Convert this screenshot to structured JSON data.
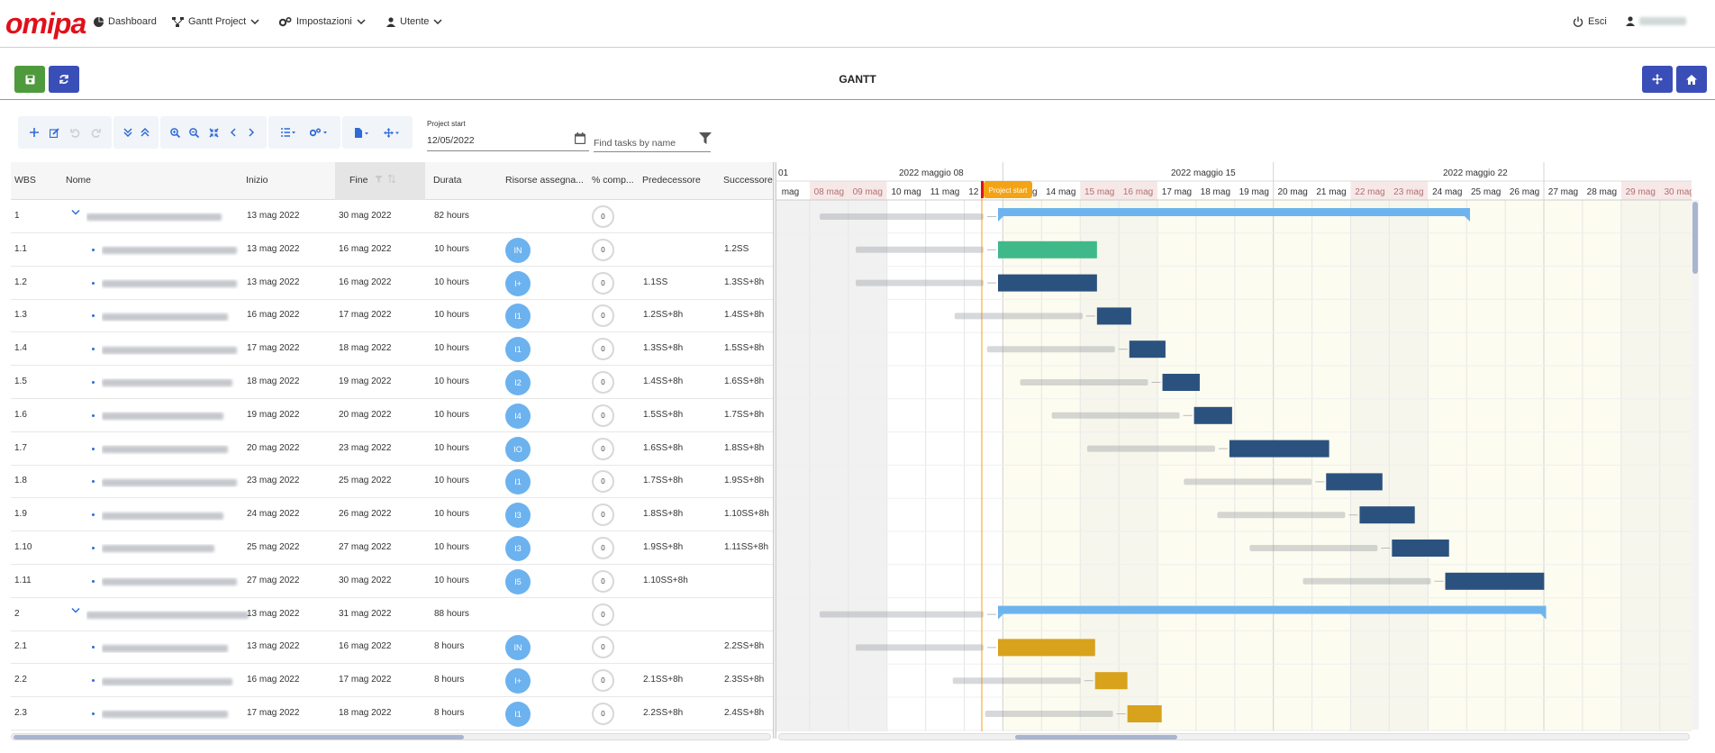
{
  "nav": {
    "logo": "omipa",
    "dashboard": "Dashboard",
    "gantt_project": "Gantt Project",
    "impostazioni": "Impostazioni",
    "utente": "Utente",
    "esci": "Esci"
  },
  "page": {
    "title": "GANTT"
  },
  "toolbar": {
    "project_start_label": "Project start",
    "project_start_value": "12/05/2022",
    "find_placeholder": "Find tasks by name"
  },
  "columns": {
    "wbs": "WBS",
    "nome": "Nome",
    "inizio": "Inizio",
    "fine": "Fine",
    "durata": "Durata",
    "risorse": "Risorse assegna...",
    "comp": "% comp...",
    "predecessore": "Predecessore",
    "successore": "Successore"
  },
  "rows": [
    {
      "wbs": "1",
      "start": "13 mag 2022",
      "end": "30 mag 2022",
      "dur": "82 hours",
      "res": "",
      "pct": "0",
      "pred": "",
      "succ": "",
      "parent": true
    },
    {
      "wbs": "1.1",
      "start": "13 mag 2022",
      "end": "16 mag 2022",
      "dur": "10 hours",
      "res": "IN",
      "pct": "0",
      "pred": "",
      "succ": "1.2SS"
    },
    {
      "wbs": "1.2",
      "start": "13 mag 2022",
      "end": "16 mag 2022",
      "dur": "10 hours",
      "res": "I+",
      "pct": "0",
      "pred": "1.1SS",
      "succ": "1.3SS+8h"
    },
    {
      "wbs": "1.3",
      "start": "16 mag 2022",
      "end": "17 mag 2022",
      "dur": "10 hours",
      "res": "I1",
      "pct": "0",
      "pred": "1.2SS+8h",
      "succ": "1.4SS+8h"
    },
    {
      "wbs": "1.4",
      "start": "17 mag 2022",
      "end": "18 mag 2022",
      "dur": "10 hours",
      "res": "I1",
      "pct": "0",
      "pred": "1.3SS+8h",
      "succ": "1.5SS+8h"
    },
    {
      "wbs": "1.5",
      "start": "18 mag 2022",
      "end": "19 mag 2022",
      "dur": "10 hours",
      "res": "I2",
      "pct": "0",
      "pred": "1.4SS+8h",
      "succ": "1.6SS+8h"
    },
    {
      "wbs": "1.6",
      "start": "19 mag 2022",
      "end": "20 mag 2022",
      "dur": "10 hours",
      "res": "I4",
      "pct": "0",
      "pred": "1.5SS+8h",
      "succ": "1.7SS+8h"
    },
    {
      "wbs": "1.7",
      "start": "20 mag 2022",
      "end": "23 mag 2022",
      "dur": "10 hours",
      "res": "IO",
      "pct": "0",
      "pred": "1.6SS+8h",
      "succ": "1.8SS+8h"
    },
    {
      "wbs": "1.8",
      "start": "23 mag 2022",
      "end": "25 mag 2022",
      "dur": "10 hours",
      "res": "I1",
      "pct": "0",
      "pred": "1.7SS+8h",
      "succ": "1.9SS+8h"
    },
    {
      "wbs": "1.9",
      "start": "24 mag 2022",
      "end": "26 mag 2022",
      "dur": "10 hours",
      "res": "I3",
      "pct": "0",
      "pred": "1.8SS+8h",
      "succ": "1.10SS+8h"
    },
    {
      "wbs": "1.10",
      "start": "25 mag 2022",
      "end": "27 mag 2022",
      "dur": "10 hours",
      "res": "I3",
      "pct": "0",
      "pred": "1.9SS+8h",
      "succ": "1.11SS+8h"
    },
    {
      "wbs": "1.11",
      "start": "27 mag 2022",
      "end": "30 mag 2022",
      "dur": "10 hours",
      "res": "I5",
      "pct": "0",
      "pred": "1.10SS+8h",
      "succ": ""
    },
    {
      "wbs": "2",
      "start": "13 mag 2022",
      "end": "31 mag 2022",
      "dur": "88 hours",
      "res": "",
      "pct": "0",
      "pred": "",
      "succ": "",
      "parent": true
    },
    {
      "wbs": "2.1",
      "start": "13 mag 2022",
      "end": "16 mag 2022",
      "dur": "8 hours",
      "res": "IN",
      "pct": "0",
      "pred": "",
      "succ": "2.2SS+8h"
    },
    {
      "wbs": "2.2",
      "start": "16 mag 2022",
      "end": "17 mag 2022",
      "dur": "8 hours",
      "res": "I+",
      "pct": "0",
      "pred": "2.1SS+8h",
      "succ": "2.3SS+8h"
    },
    {
      "wbs": "2.3",
      "start": "17 mag 2022",
      "end": "18 mag 2022",
      "dur": "8 hours",
      "res": "I1",
      "pct": "0",
      "pred": "2.2SS+8h",
      "succ": "2.4SS+8h"
    }
  ],
  "timeline": {
    "weeks": [
      "01",
      "2022 maggio 08",
      "2022 maggio 15",
      "2022 maggio 22"
    ],
    "days": [
      "mag",
      "08 mag",
      "09 mag",
      "10 mag",
      "11 mag",
      "12 mag",
      "13 mag",
      "14 mag",
      "15 mag",
      "16 mag",
      "17 mag",
      "18 mag",
      "19 mag",
      "20 mag",
      "21 mag",
      "22 mag",
      "23 mag",
      "24 mag",
      "25 mag",
      "26 mag",
      "27 mag",
      "28 mag",
      "29 mag",
      "30 mag"
    ],
    "project_start_flag": "Project start"
  },
  "colors": {
    "parent_bar": "#6db4ee",
    "bar_green": "#3fb98a",
    "bar_navy": "#2b527f",
    "bar_gold": "#d8a21c",
    "accent": "#3a4eb8",
    "flag": "#f3a313"
  }
}
